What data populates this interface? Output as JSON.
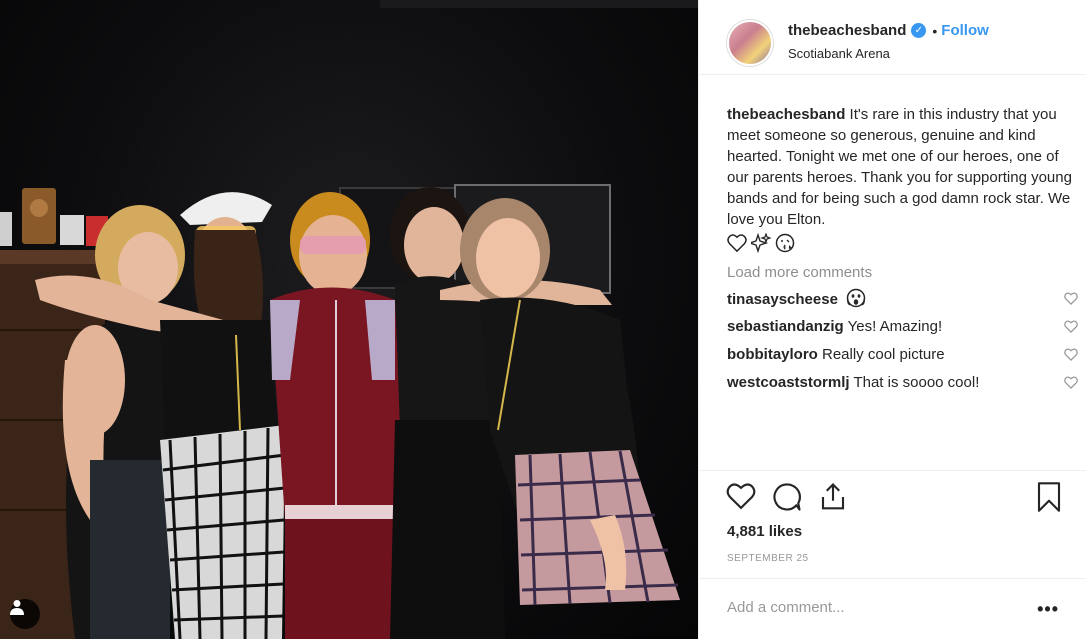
{
  "post": {
    "username": "thebeachesband",
    "follow_label": "Follow",
    "separator": "•",
    "location": "Scotiabank Arena"
  },
  "caption": {
    "username": "thebeachesband",
    "text": "It's rare in this industry that you meet someone so generous, genuine and kind hearted. Tonight we met one of our heroes, one of our parents heroes. Thank you for supporting young bands and for being such a god damn rock star. We love you Elton."
  },
  "load_more_label": "Load more comments",
  "comments": [
    {
      "username": "tinasayscheese",
      "text": ""
    },
    {
      "username": "sebastiandanzig",
      "text": "Yes! Amazing!"
    },
    {
      "username": "bobbitayloro",
      "text": "Really cool picture"
    },
    {
      "username": "westcoaststormlj",
      "text": "That is soooo cool!"
    }
  ],
  "likes": "4,881 likes",
  "date": "SEPTEMBER 25",
  "add_comment_placeholder": "Add a comment...",
  "more_label": "•••",
  "colors": {
    "link_blue": "#3897f0",
    "text": "#262626",
    "muted": "#8e8e8e"
  },
  "icons": [
    "verified-badge-icon",
    "heart-icon",
    "comment-icon",
    "share-icon",
    "bookmark-icon",
    "tag-user-icon",
    "more-options-icon"
  ]
}
